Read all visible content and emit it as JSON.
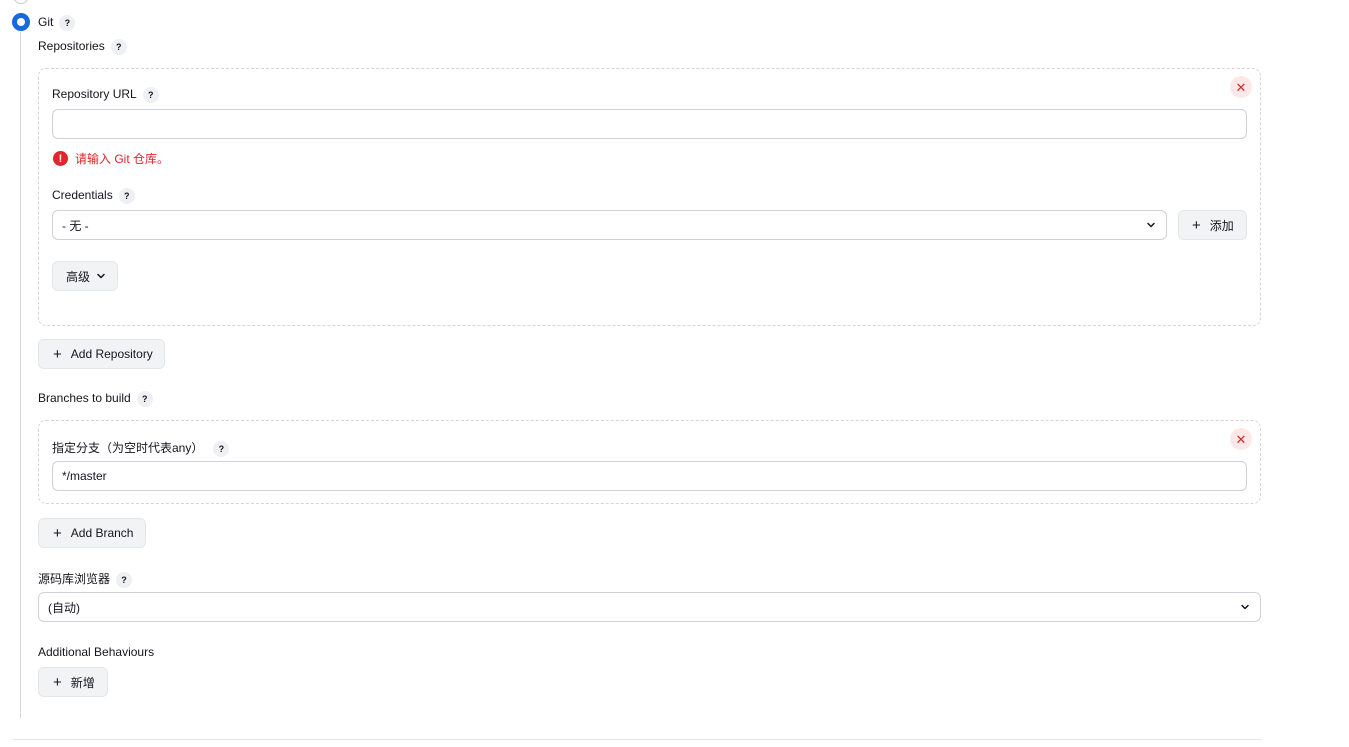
{
  "scm": {
    "git_label": "Git",
    "repositories_label": "Repositories",
    "repository": {
      "url_label": "Repository URL",
      "url_value": "",
      "url_error": "请输入 Git 仓库。",
      "credentials_label": "Credentials",
      "credentials_selected": "- 无 -",
      "add_credentials_label": "添加",
      "advanced_label": "高级"
    },
    "add_repository_label": "Add Repository",
    "branches_label": "Branches to build",
    "branch": {
      "specifier_label": "指定分支（为空时代表any）",
      "specifier_value": "*/master"
    },
    "add_branch_label": "Add Branch",
    "browser_label": "源码库浏览器",
    "browser_selected": "(自动)",
    "behaviours_label": "Additional Behaviours",
    "add_behaviour_label": "新增",
    "help_glyph": "?",
    "close_glyph": "✕",
    "error_glyph": "!"
  }
}
